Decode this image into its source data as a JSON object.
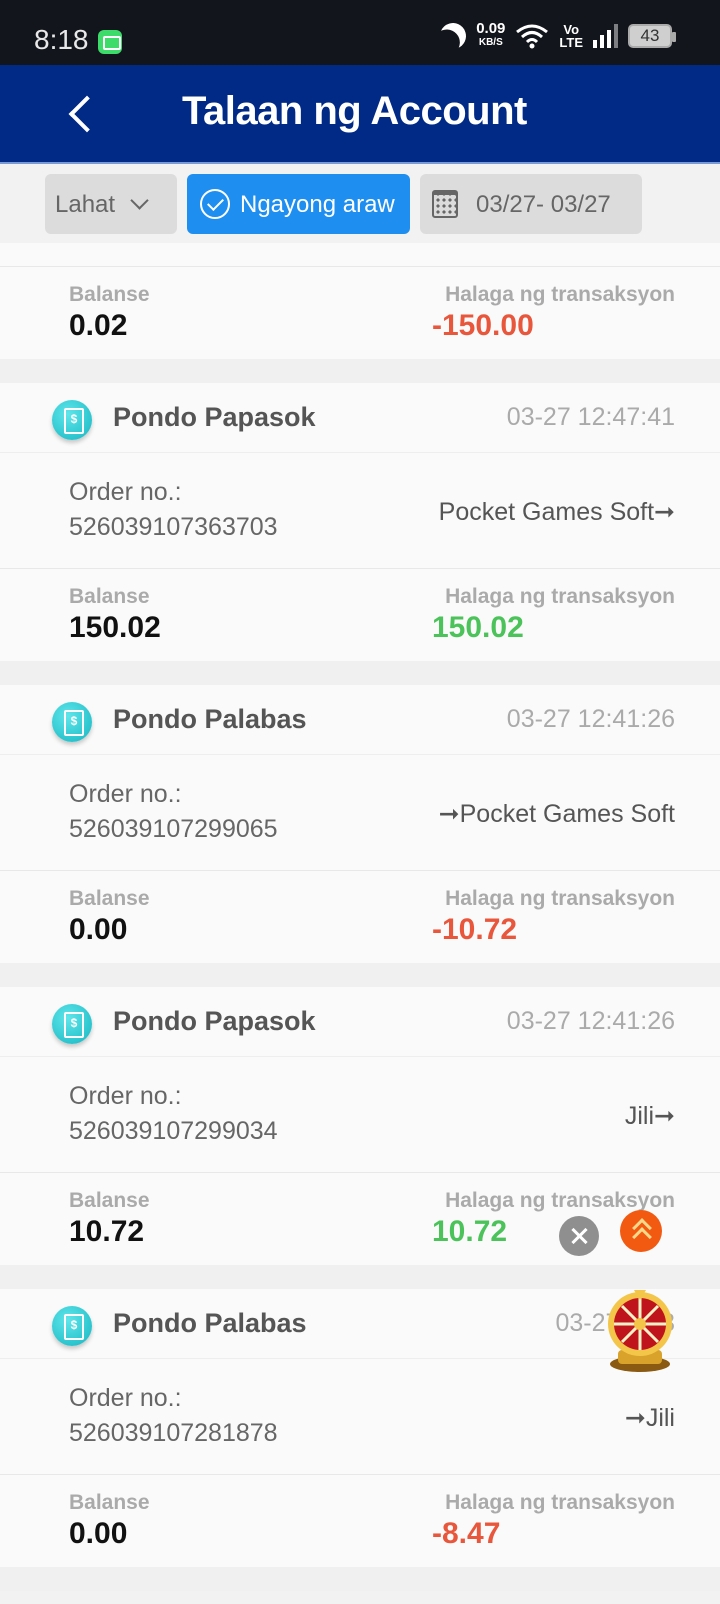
{
  "status_bar": {
    "time": "8:18",
    "net_speed": "0.09",
    "net_unit": "KB/S",
    "volte_top": "Vo",
    "volte_bottom": "LTE",
    "battery": "43"
  },
  "header": {
    "title": "Talaan ng Account"
  },
  "filters": {
    "type_label": "Lahat",
    "today_label": "Ngayong araw",
    "date_range": "03/27- 03/27"
  },
  "labels": {
    "order_no": "Order no.:",
    "balance": "Balanse",
    "amount": "Halaga ng transaksyon"
  },
  "partial_record": {
    "balance": "0.02",
    "amount": "-150.00"
  },
  "records": [
    {
      "type": "Pondo Papasok",
      "time": "03-27 12:47:41",
      "order_no": "526039107363703",
      "provider": "Pocket Games Soft➞",
      "balance": "150.02",
      "amount": "150.02"
    },
    {
      "type": "Pondo Palabas",
      "time": "03-27 12:41:26",
      "order_no": "526039107299065",
      "provider": "➞Pocket Games Soft",
      "balance": "0.00",
      "amount": "-10.72"
    },
    {
      "type": "Pondo Papasok",
      "time": "03-27 12:41:26",
      "order_no": "526039107299034",
      "provider": "Jili➞",
      "balance": "10.72",
      "amount": "10.72"
    },
    {
      "type": "Pondo Palabas",
      "time": "03-27 12:3",
      "order_no": "526039107281878",
      "provider": "➞Jili",
      "balance": "0.00",
      "amount": "-8.47"
    }
  ],
  "colors": {
    "header_bg": "#002a86",
    "active_filter": "#1e8ef0",
    "negative": "#e8573c",
    "positive": "#4cc35a"
  }
}
